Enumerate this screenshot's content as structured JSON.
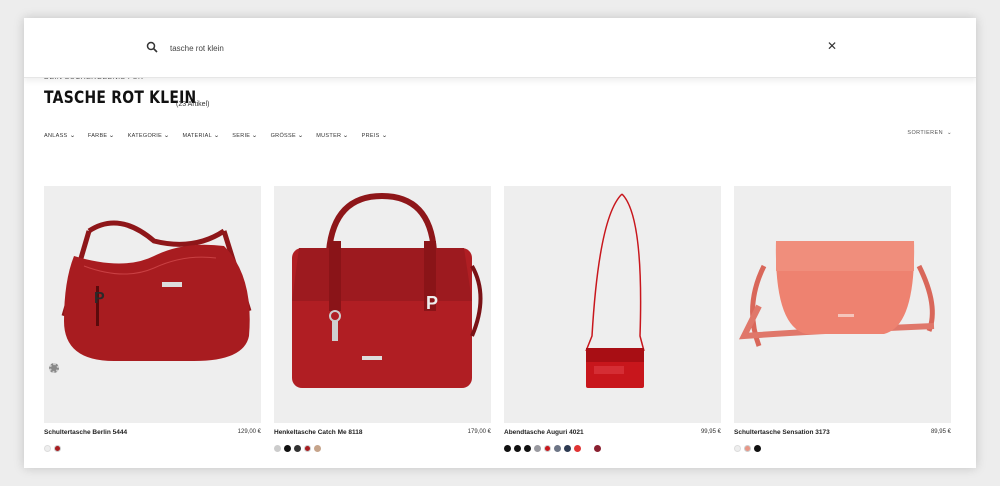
{
  "search": {
    "value": "tasche rot klein",
    "placeholder": ""
  },
  "results": {
    "pre_title": "DEIN SUCHERGEBNIS FÜR",
    "title": "TASCHE ROT KLEIN",
    "count": "(23 Artikel)"
  },
  "filters": [
    "ANLASS",
    "FARBE",
    "KATEGORIE",
    "MATERIAL",
    "SERIE",
    "GRÖSSE",
    "MUSTER",
    "PREIS"
  ],
  "sort_label": "SORTIEREN",
  "products": [
    {
      "name": "Schultertasche Berlin 5444",
      "price": "129,00 €",
      "color": "#a81c20",
      "swatches": [
        "#eeeeee",
        "#a81c20"
      ]
    },
    {
      "name": "Henkeltasche Catch Me 8118",
      "price": "179,00 €",
      "color": "#b01e23",
      "swatches": [
        "#cccccc",
        "#111111",
        "#333333",
        "#a81c20",
        "#c6a48b"
      ]
    },
    {
      "name": "Abendtasche Auguri 4021",
      "price": "99,95 €",
      "color": "#c8161c",
      "swatches": [
        "#111111",
        "#111111",
        "#111111",
        "#9a9aa0",
        "#c8161c",
        "#6d7586",
        "#2d3a52",
        "#e03434",
        "#ffffff",
        "#8a2030"
      ]
    },
    {
      "name": "Schultertasche Sensation 3173",
      "price": "89,95 €",
      "color": "#ee8270",
      "swatches": [
        "#eeeeee",
        "#e89686",
        "#111111"
      ]
    }
  ],
  "icons": {
    "search": "search-icon",
    "close": "close-icon",
    "chevron": "chevron-down-icon"
  },
  "colors": {
    "accent": "#a81c20",
    "background": "#ffffff",
    "image_bg": "#eeeeee"
  }
}
